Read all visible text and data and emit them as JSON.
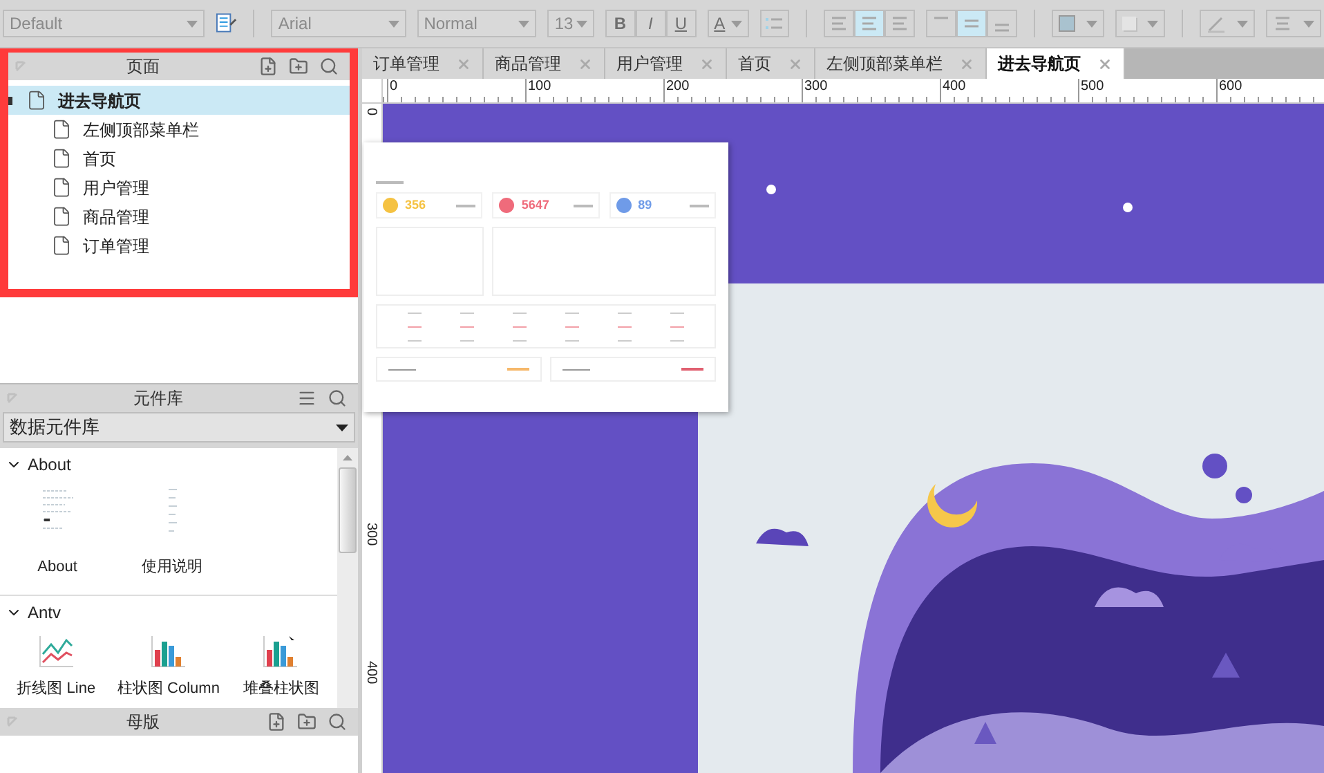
{
  "toolbar": {
    "style_field": "Default",
    "font_field": "Arial",
    "weight_field": "Normal",
    "size_field": "13",
    "format_buttons": [
      "B",
      "I",
      "U"
    ],
    "text_color_label": "A",
    "align_buttons": [
      {
        "selected": false
      },
      {
        "selected": true
      },
      {
        "selected": false
      }
    ],
    "valign_buttons": [
      {
        "selected": false
      },
      {
        "selected": true
      },
      {
        "selected": false
      }
    ]
  },
  "pages_panel": {
    "title": "页面",
    "tree": [
      {
        "label": "进去导航页",
        "selected": true,
        "expanded": true,
        "children": [
          {
            "label": "左侧顶部菜单栏",
            "selected": false
          },
          {
            "label": "首页",
            "selected": false
          },
          {
            "label": "用户管理",
            "selected": false
          },
          {
            "label": "商品管理",
            "selected": false
          },
          {
            "label": "订单管理",
            "selected": false
          }
        ]
      }
    ]
  },
  "library_panel": {
    "title": "元件库",
    "library_select": "数据元件库",
    "sections": [
      {
        "title": "About",
        "expanded": true,
        "items": [
          {
            "label": "About",
            "kind": "thumb"
          },
          {
            "label": "使用说明",
            "kind": "thumb-narrow"
          }
        ]
      },
      {
        "title": "Antv",
        "expanded": true,
        "items": [
          {
            "label": "折线图 Line",
            "kind": "line-chart"
          },
          {
            "label": "柱状图 Column",
            "kind": "column-chart"
          },
          {
            "label": "堆叠柱状图",
            "kind": "stacked-chart"
          }
        ]
      }
    ]
  },
  "masters_panel": {
    "title": "母版"
  },
  "tabs": [
    {
      "label": "订单管理",
      "selected": false
    },
    {
      "label": "商品管理",
      "selected": false
    },
    {
      "label": "用户管理",
      "selected": false
    },
    {
      "label": "首页",
      "selected": false
    },
    {
      "label": "左侧顶部菜单栏",
      "selected": false
    },
    {
      "label": "进去导航页",
      "selected": true
    }
  ],
  "ruler": {
    "x_labels": [
      "0",
      "100",
      "200",
      "300",
      "400",
      "500",
      "600"
    ],
    "y_labels": [
      "0",
      "300",
      "400"
    ]
  },
  "preview": {
    "stats": [
      {
        "value": "356",
        "color": "#f5c242"
      },
      {
        "value": "5647",
        "color": "#ef6b7b"
      },
      {
        "value": "89",
        "color": "#6f9be8"
      }
    ]
  }
}
